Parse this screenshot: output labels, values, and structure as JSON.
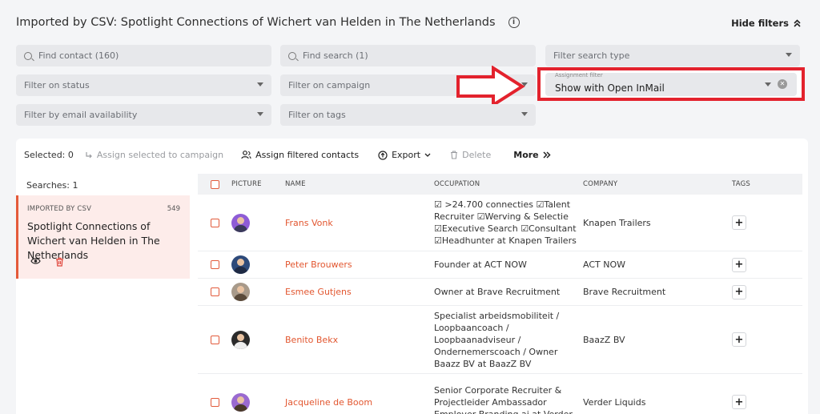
{
  "header": {
    "title": "Imported by CSV: Spotlight Connections of Wichert van Helden in The Netherlands",
    "info_icon": "i",
    "hide_filters_label": "Hide filters",
    "hide_filters_icon": "chevron-double-up-icon"
  },
  "filters": {
    "find_contact": "Find contact (160)",
    "find_search": "Find search (1)",
    "search_type": "Filter search type",
    "status": "Filter on status",
    "campaign": "Filter on campaign",
    "assignment_label": "Assignment filter",
    "assignment_value": "Show with Open InMail",
    "email": "Filter by email availability",
    "tags": "Filter on tags"
  },
  "highlight_color": "#e3222d",
  "toolbar": {
    "selected": "Selected: 0",
    "assign_selected": "Assign selected to campaign",
    "assign_filtered": "Assign filtered contacts",
    "export": "Export",
    "delete": "Delete",
    "more": "More"
  },
  "sidebar": {
    "searches": "Searches:  1",
    "card": {
      "tag": "IMPORTED BY CSV",
      "count": "549",
      "title": "Spotlight Connections of Wichert van Helden in The Netherlands"
    }
  },
  "table": {
    "headers": {
      "picture": "PICTURE",
      "name": "NAME",
      "occupation": "OCCUPATION",
      "company": "COMPANY",
      "tags": "TAGS"
    },
    "rows": [
      {
        "name": "Frans Vonk",
        "occupation": "☑ >24.700 connecties ☑Talent Recruiter ☑Werving & Selectie ☑Executive Search ☑Consultant ☑Headhunter at Knapen Trailers",
        "company": "Knapen Trailers",
        "tag_button": "+"
      },
      {
        "name": "Peter Brouwers",
        "occupation": "Founder at ACT NOW",
        "company": "ACT NOW",
        "tag_button": "+"
      },
      {
        "name": "Esmee Gutjens",
        "occupation": "Owner at Brave Recruitment",
        "company": "Brave Recruitment",
        "tag_button": "+"
      },
      {
        "name": "Benito Bekx",
        "occupation": "Specialist arbeidsmobiliteit / Loopbaancoach / Loopbaanadviseur / Ondernemerscoach / Owner Baazz BV at BaazZ BV",
        "company": "BaazZ BV",
        "tag_button": "+"
      },
      {
        "name": "Jacqueline de Boom",
        "occupation": "Senior Corporate Recruiter & Projectleider Ambassador Employer Branding ai at Verder",
        "company": "Verder Liquids",
        "tag_button": "+"
      }
    ]
  }
}
